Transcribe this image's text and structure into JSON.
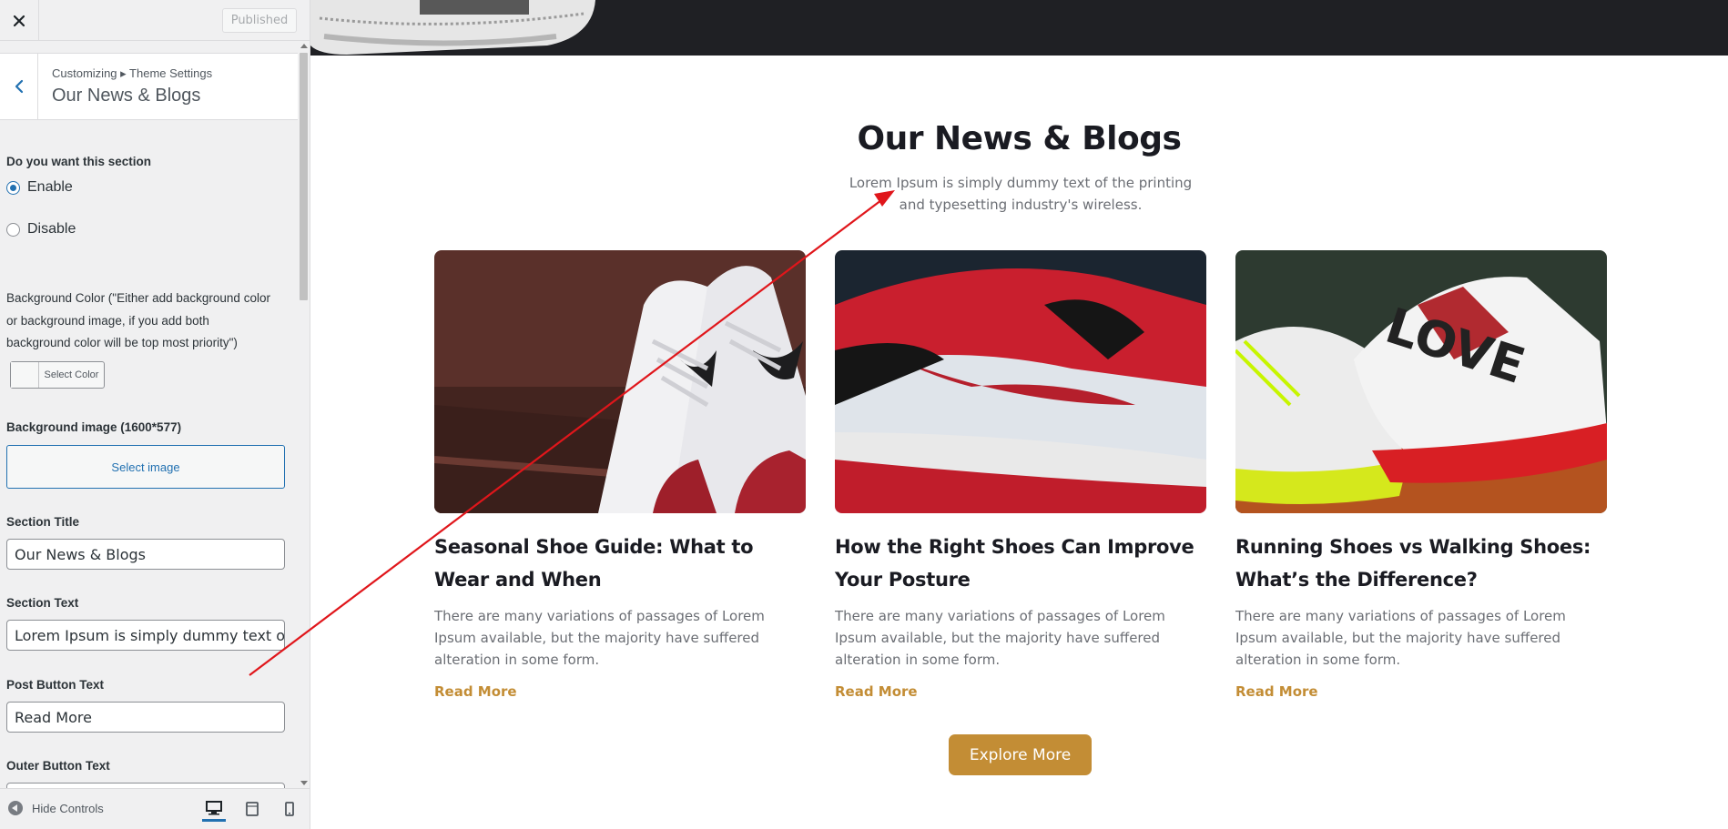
{
  "topbar": {
    "close_icon": "close-icon",
    "publish_label": "Published"
  },
  "section": {
    "breadcrumb": "Customizing ▸ Theme Settings",
    "title": "Our News & Blogs"
  },
  "controls": {
    "enable_question": "Do you want this section",
    "enable_label": "Enable",
    "disable_label": "Disable",
    "enable_selected": "enable",
    "bg_color_label": "Background Color (\"Either add background color or background image, if you add both background color will be top most priority\")",
    "select_color_label": "Select Color",
    "bg_image_label": "Background image (1600*577)",
    "select_image_label": "Select image",
    "section_title_label": "Section Title",
    "section_title_value": "Our News & Blogs",
    "section_text_label": "Section Text",
    "section_text_value": "Lorem Ipsum is simply dummy text of the printing",
    "post_button_label": "Post Button Text",
    "post_button_value": "Read More",
    "outer_button_label": "Outer Button Text"
  },
  "bottombar": {
    "hide_controls": "Hide Controls"
  },
  "preview": {
    "title": "Our News & Blogs",
    "text": "Lorem Ipsum is simply dummy text of the printing and typesetting industry's wireless.",
    "cards": [
      {
        "title": "Seasonal Shoe Guide: What to Wear and When",
        "excerpt": "There are many variations of passages of Lorem Ipsum available, but the majority have suffered alteration in some form.",
        "read_more": "Read More"
      },
      {
        "title": "How the Right Shoes Can Improve Your Posture",
        "excerpt": "There are many variations of passages of Lorem Ipsum available, but the majority have suffered alteration in some form.",
        "read_more": "Read More"
      },
      {
        "title": "Running Shoes vs Walking Shoes: What’s the Difference?",
        "excerpt": "There are many variations of passages of Lorem Ipsum available, but the majority have suffered alteration in some form.",
        "read_more": "Read More"
      }
    ],
    "explore_label": "Explore More"
  },
  "colors": {
    "accent": "#c38d35",
    "wp_blue": "#2271b1",
    "annotation_arrow": "#e0161b",
    "dark_band": "#1f2024"
  }
}
